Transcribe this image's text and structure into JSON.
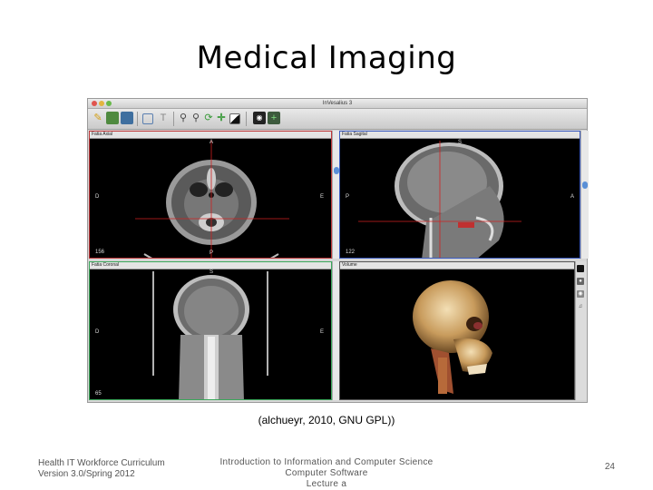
{
  "slide": {
    "title": "Medical Imaging",
    "caption": "(alchueyr, 2010, GNU GPL))",
    "footer": {
      "left_line1": "Health IT Workforce Curriculum",
      "left_line2": "Version 3.0/Spring 2012",
      "center_line1": "Introduction to Information and Computer Science",
      "center_line2": "Computer Software",
      "center_line3": "Lecture a",
      "page_number": "24"
    }
  },
  "app": {
    "window_title": "InVesalius 3",
    "toolbar": {
      "buttons": [
        {
          "icon": "pointer-icon",
          "label": ""
        },
        {
          "icon": "color-icon",
          "label": ""
        },
        {
          "icon": "layout-icon",
          "label": ""
        },
        {
          "icon": "window-icon",
          "label": ""
        },
        {
          "icon": "text-icon",
          "label": "T"
        },
        {
          "icon": "zoom-in-icon",
          "label": ""
        },
        {
          "icon": "zoom-out-icon",
          "label": ""
        },
        {
          "icon": "rotate-icon",
          "label": ""
        },
        {
          "icon": "pan-icon",
          "label": ""
        },
        {
          "icon": "contrast-icon",
          "label": ""
        },
        {
          "icon": "camera-icon",
          "label": ""
        },
        {
          "icon": "crosshair-icon",
          "label": ""
        }
      ]
    },
    "viewports": {
      "axial": {
        "header": "Fatia Axial",
        "top": "A",
        "bottom": "P",
        "left": "D",
        "right": "E",
        "slice": "156"
      },
      "sagittal": {
        "header": "Fatia Sagital",
        "top": "S",
        "bottom": "",
        "left": "P",
        "right": "A",
        "slice": "122"
      },
      "coronal": {
        "header": "Fatia Coronal",
        "top": "S",
        "bottom": "",
        "left": "D",
        "right": "E",
        "slice": "65"
      },
      "volume": {
        "header": "Volume"
      }
    },
    "colors": {
      "axial_border": "#c0393b",
      "sagittal_border": "#3b5bc0",
      "coronal_border": "#3ba85b",
      "crosshair": "#d02020"
    }
  }
}
